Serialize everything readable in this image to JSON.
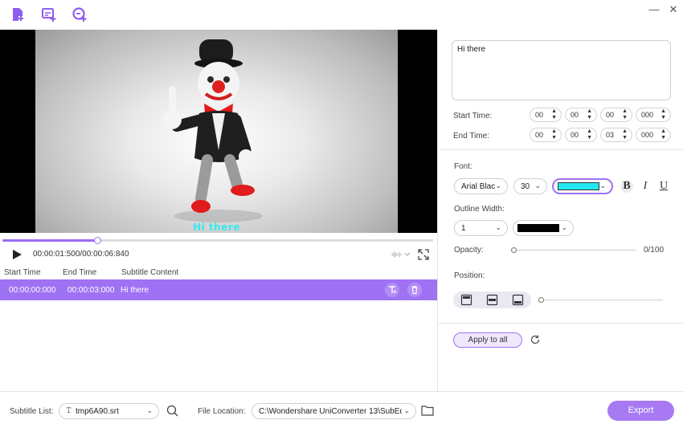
{
  "toolbar": {
    "icons": [
      "add-file-icon",
      "add-subtitle-icon",
      "create-subtitle-icon"
    ],
    "minimize_glyph": "—",
    "close_glyph": "✕"
  },
  "player": {
    "overlay_subtitle": "Hi there",
    "time_display": "00:00:01:500/00:00:06:840",
    "progress": 0.22
  },
  "table": {
    "headers": [
      "Start Time",
      "End Time",
      "Subtitle Content"
    ],
    "rows": [
      {
        "start": "00:00:00:000",
        "end": "00:00:03:000",
        "content": "Hi there"
      }
    ]
  },
  "editor": {
    "text": "Hi there",
    "start_label": "Start Time:",
    "end_label": "End Time:",
    "start_time": [
      "00",
      "00",
      "00",
      "000"
    ],
    "end_time": [
      "00",
      "00",
      "03",
      "000"
    ]
  },
  "style": {
    "font_label": "Font:",
    "font_family": "Arial Blac",
    "font_size": "30",
    "font_color": "#22e8f0",
    "bold": "B",
    "italic": "I",
    "underline": "U",
    "outline_label": "Outline Width:",
    "outline_width": "1",
    "outline_color": "#000000",
    "opacity_label": "Opacity:",
    "opacity_value": "0/100",
    "position_label": "Position:",
    "apply_label": "Apply to all"
  },
  "bottom": {
    "subtitle_list_label": "Subtitle List:",
    "subtitle_file": "tmp6A90.srt",
    "file_location_label": "File Location:",
    "file_location": "C:\\Wondershare UniConverter 13\\SubEd",
    "export_label": "Export"
  },
  "colors": {
    "accent": "#9f72f3",
    "subtitle_text": "#35e8f0"
  }
}
